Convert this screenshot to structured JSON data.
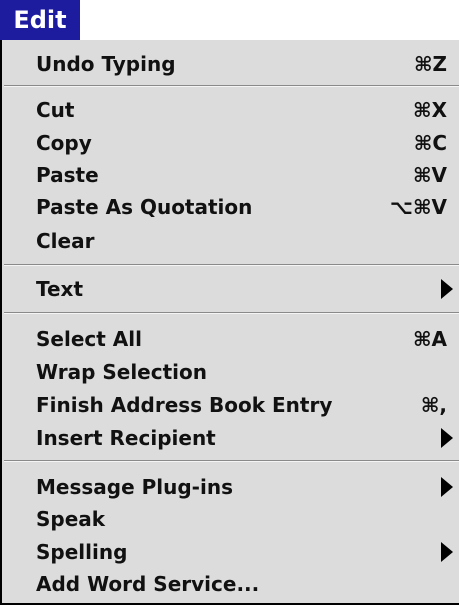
{
  "menu": {
    "title": "Edit",
    "items": [
      {
        "label": "Undo Typing",
        "shortcut": "⌘Z"
      },
      {
        "label": "Cut",
        "shortcut": "⌘X"
      },
      {
        "label": "Copy",
        "shortcut": "⌘C"
      },
      {
        "label": "Paste",
        "shortcut": "⌘V"
      },
      {
        "label": "Paste As Quotation",
        "shortcut": "⌥⌘V"
      },
      {
        "label": "Clear",
        "shortcut": ""
      },
      {
        "label": "Text",
        "shortcut": ""
      },
      {
        "label": "Select All",
        "shortcut": "⌘A"
      },
      {
        "label": "Wrap Selection",
        "shortcut": ""
      },
      {
        "label": "Finish Address Book Entry",
        "shortcut": "⌘,"
      },
      {
        "label": "Insert Recipient",
        "shortcut": ""
      },
      {
        "label": "Message Plug-ins",
        "shortcut": ""
      },
      {
        "label": "Speak",
        "shortcut": ""
      },
      {
        "label": "Spelling",
        "shortcut": ""
      },
      {
        "label": "Add Word Service...",
        "shortcut": ""
      }
    ]
  },
  "colors": {
    "title_bg": "#1d1b9e",
    "menu_bg": "#dcdcdc"
  }
}
